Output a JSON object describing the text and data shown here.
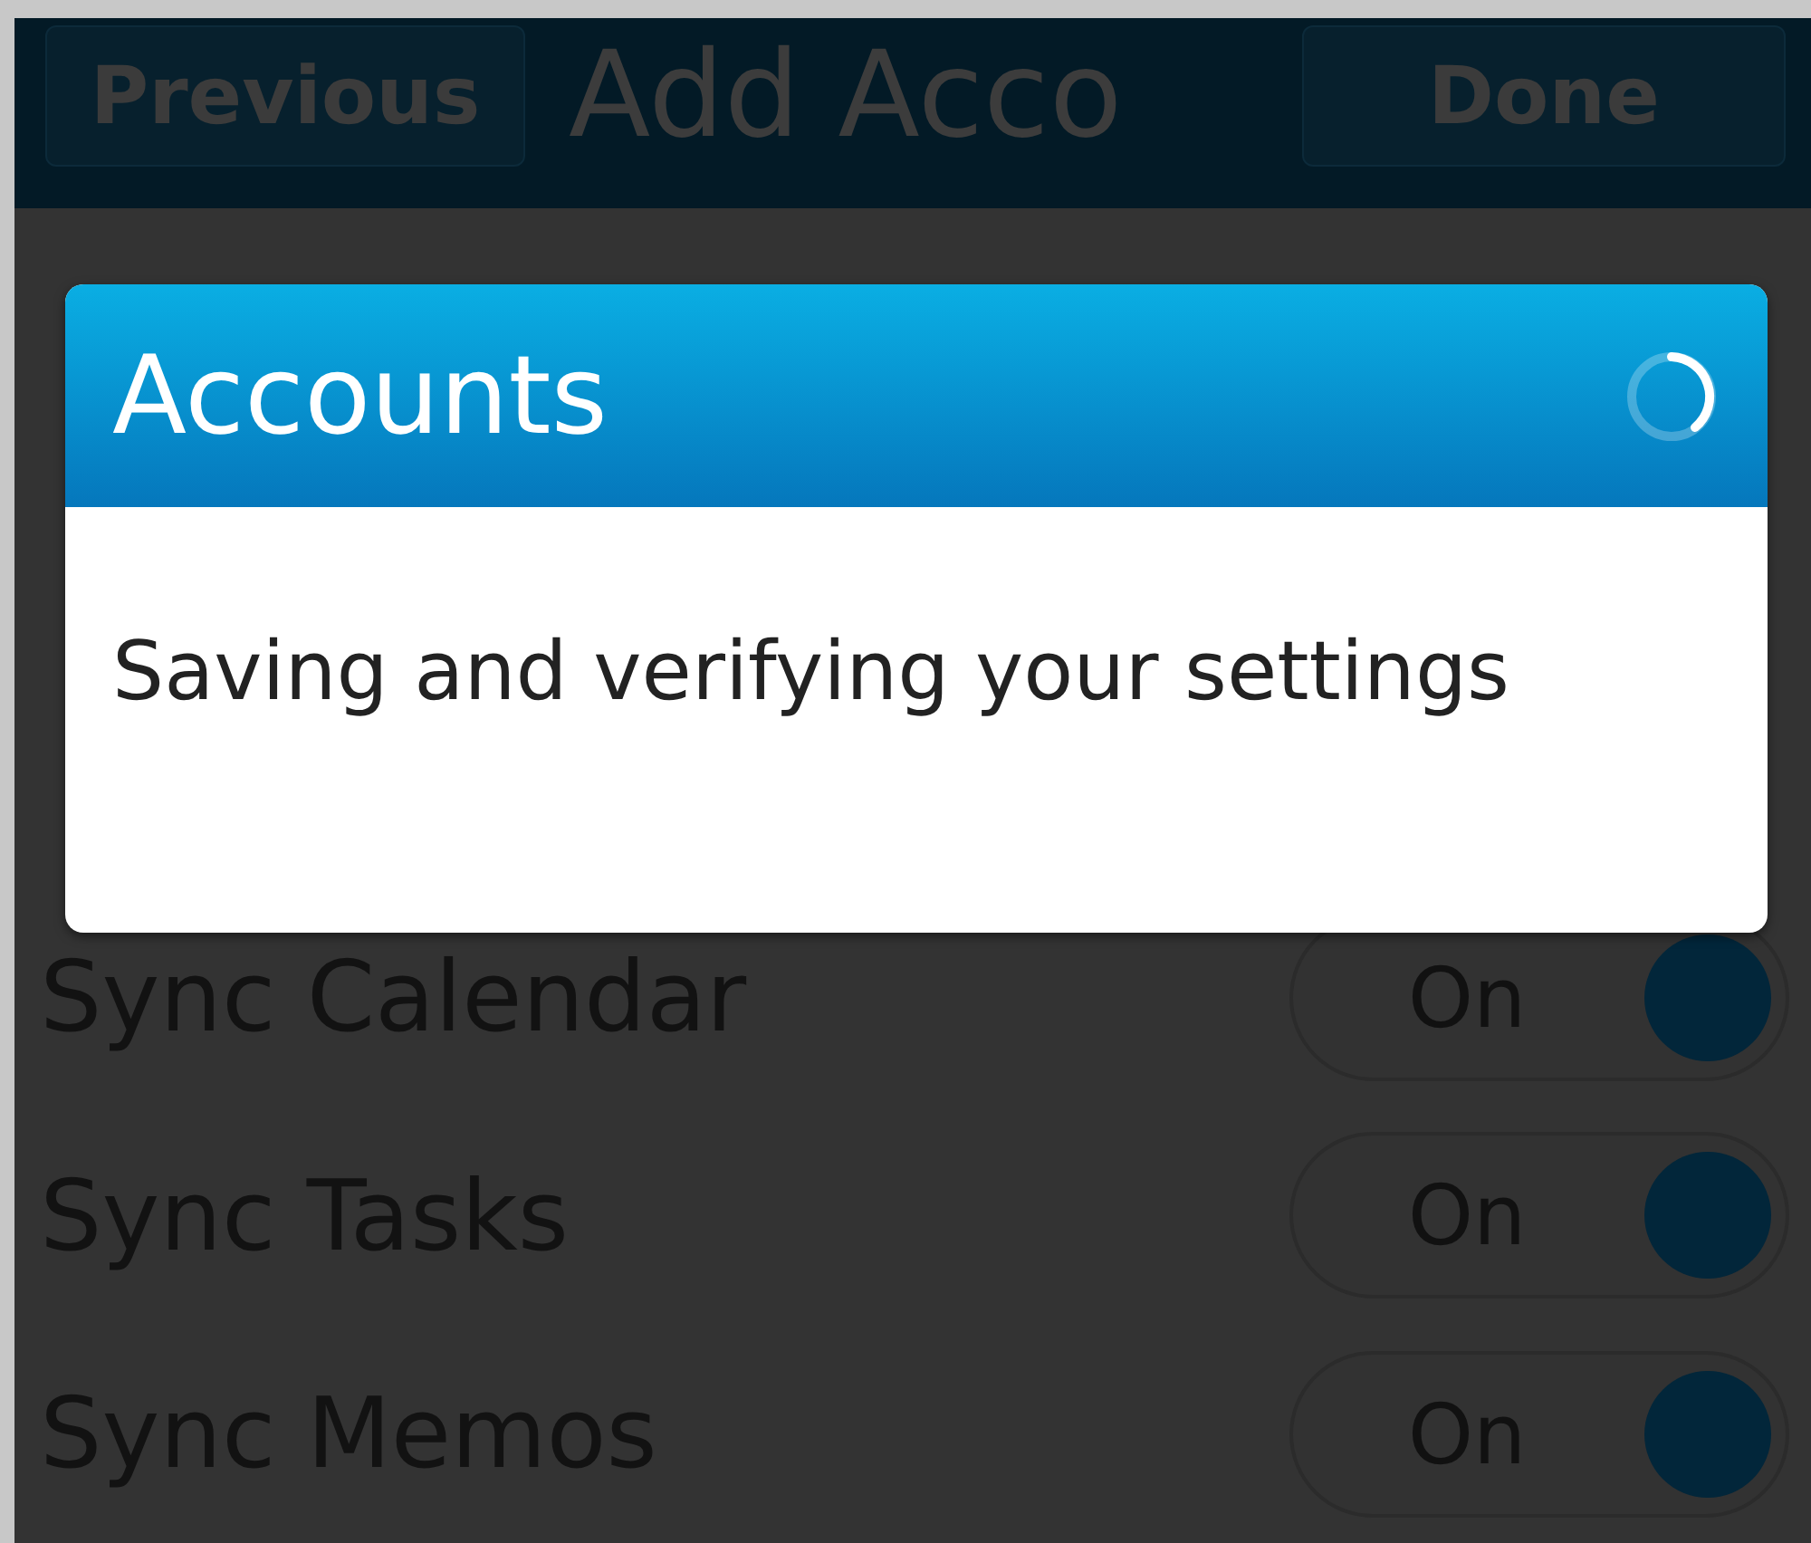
{
  "title_bar": {
    "previous_button": "Previous",
    "title": "Add Acco",
    "done_button": "Done"
  },
  "rows": [
    {
      "label": "Sync Calendar",
      "toggle_text": "On",
      "on": true
    },
    {
      "label": "Sync Tasks",
      "toggle_text": "On",
      "on": true
    },
    {
      "label": "Sync Memos",
      "toggle_text": "On",
      "on": true
    }
  ],
  "dialog": {
    "title": "Accounts",
    "busy": true,
    "message": "Saving and verifying your settings"
  }
}
